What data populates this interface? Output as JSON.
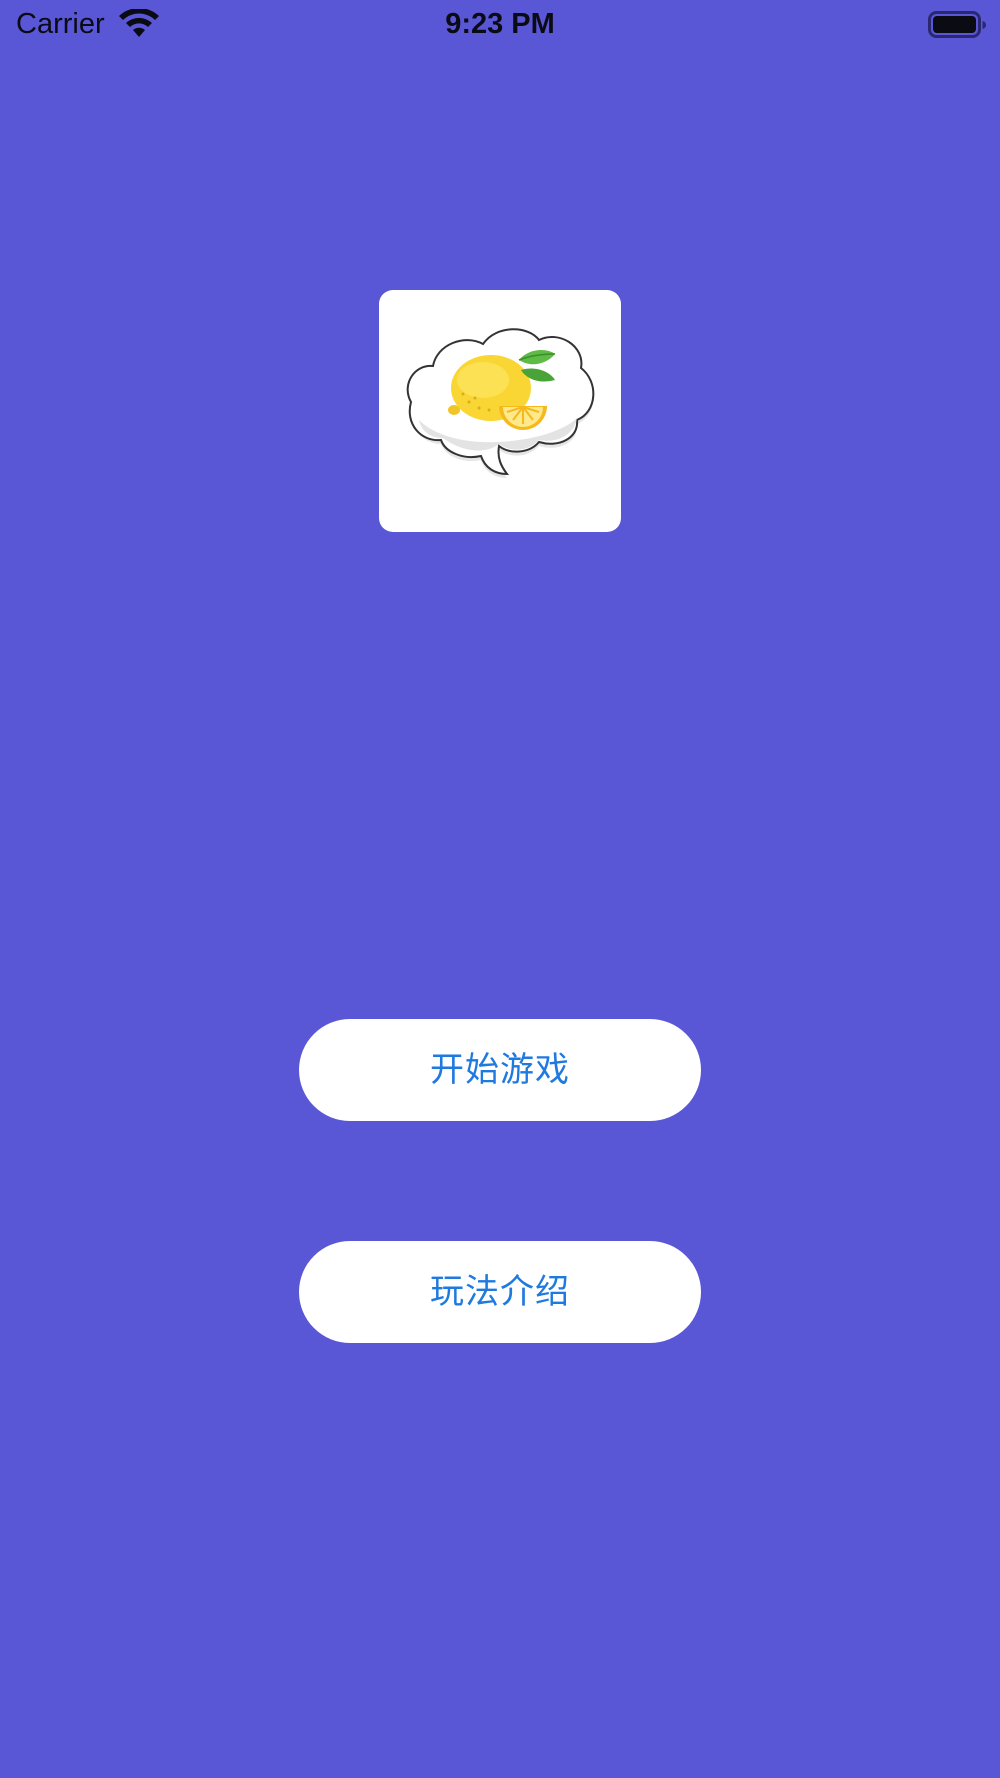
{
  "status_bar": {
    "carrier": "Carrier",
    "time": "9:23 PM",
    "icons": [
      "wifi-icon",
      "battery-icon"
    ]
  },
  "app_icon": {
    "name": "lemon-speech-bubble-icon"
  },
  "buttons": {
    "start_label": "开始游戏",
    "rules_label": "玩法介绍"
  },
  "colors": {
    "background": "#5A57D7",
    "button_bg": "#FFFFFF",
    "button_text": "#1F7AE0",
    "lemon": "#F9D633",
    "leaf": "#5DBB46"
  }
}
